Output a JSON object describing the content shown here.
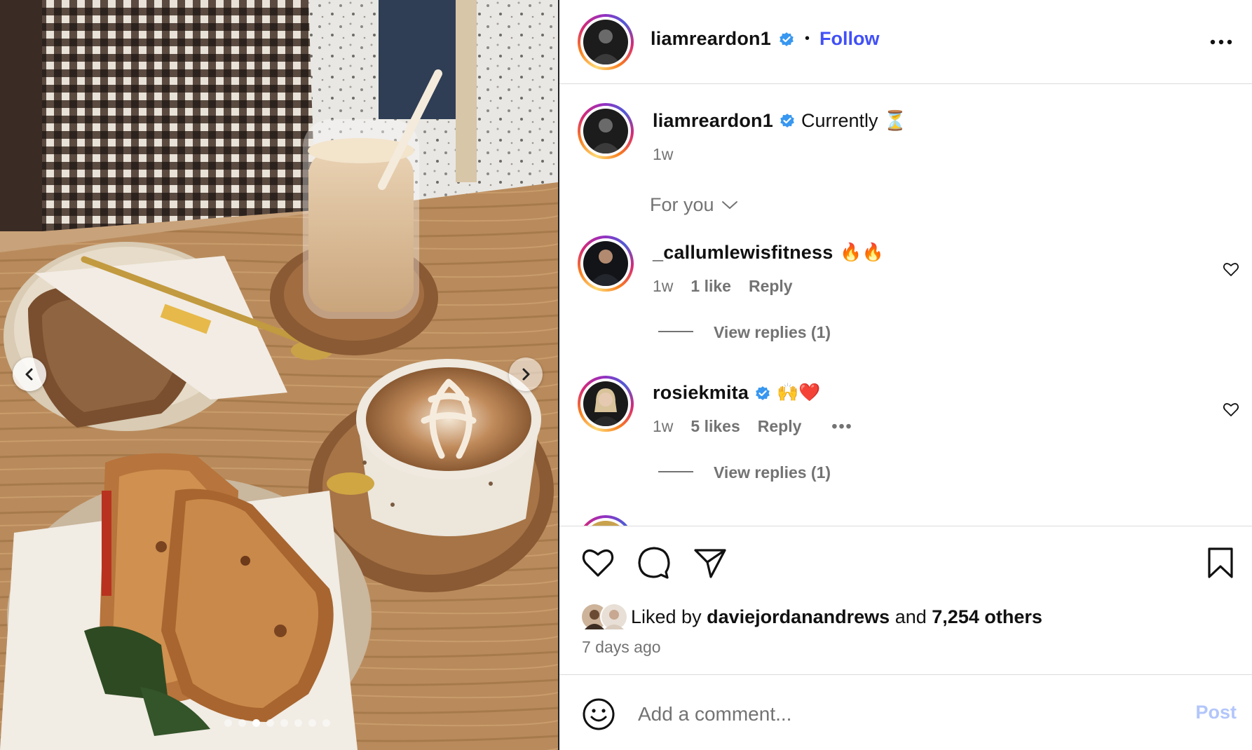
{
  "post": {
    "author": "liamreardon1",
    "verified_icon": "verified-badge-icon",
    "follow_label": "Follow",
    "separator": "•",
    "more_icon": "more-options-icon"
  },
  "photo": {
    "prev_icon": "chevron-left-icon",
    "next_icon": "chevron-right-icon",
    "slide_count": 8,
    "active_slide": 2
  },
  "caption": {
    "username": "liamreardon1",
    "text": "Currently ⏳",
    "time": "1w"
  },
  "filter": {
    "label": "For you",
    "icon": "chevron-down-icon"
  },
  "comments": [
    {
      "username": "_callumlewisfitness",
      "text": "🔥🔥",
      "time": "1w",
      "likes": "1 like",
      "reply_label": "Reply",
      "view_replies": "View replies (1)"
    },
    {
      "username": "rosiekmita",
      "text": "🙌❤️",
      "time": "1w",
      "likes": "5 likes",
      "reply_label": "Reply",
      "more_label": "•••",
      "view_replies": "View replies (1)"
    }
  ],
  "actions": {
    "like_icon": "heart-icon",
    "comment_icon": "comment-icon",
    "share_icon": "send-icon",
    "save_icon": "bookmark-icon"
  },
  "likes": {
    "prefix": "Liked by",
    "user": "daviejordanandrews",
    "and": "and",
    "others": "7,254 others",
    "date": "7 days ago"
  },
  "comment_bar": {
    "emoji_icon": "emoji-icon",
    "placeholder": "Add a comment...",
    "post_label": "Post"
  },
  "colors": {
    "accent": "#4150f7",
    "verified": "#3897f0",
    "muted": "#737373",
    "post_disabled": "#b2c6fb",
    "heart_red": "#d91e1e"
  }
}
